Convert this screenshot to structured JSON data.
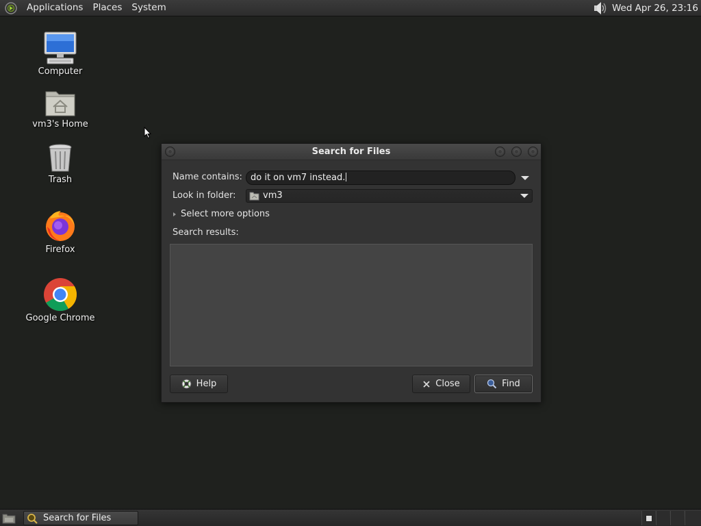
{
  "top_panel": {
    "menus": [
      "Applications",
      "Places",
      "System"
    ],
    "clock": "Wed Apr 26, 23:16"
  },
  "desktop": {
    "icons": [
      {
        "label": "Computer",
        "icon": "computer-icon"
      },
      {
        "label": "vm3's Home",
        "icon": "home-folder-icon"
      },
      {
        "label": "Trash",
        "icon": "trash-icon"
      },
      {
        "label": "Firefox",
        "icon": "firefox-icon"
      },
      {
        "label": "Google Chrome",
        "icon": "chrome-icon"
      }
    ]
  },
  "dialog": {
    "title": "Search for Files",
    "name_label": "Name contains:",
    "name_value": "do it on vm7 instead.",
    "folder_label": "Look in folder:",
    "folder_value": "vm3",
    "more_options": "Select more options",
    "results_label": "Search results:",
    "help_label": "Help",
    "close_label": "Close",
    "find_label": "Find"
  },
  "taskbar": {
    "task_label": "Search for Files"
  }
}
